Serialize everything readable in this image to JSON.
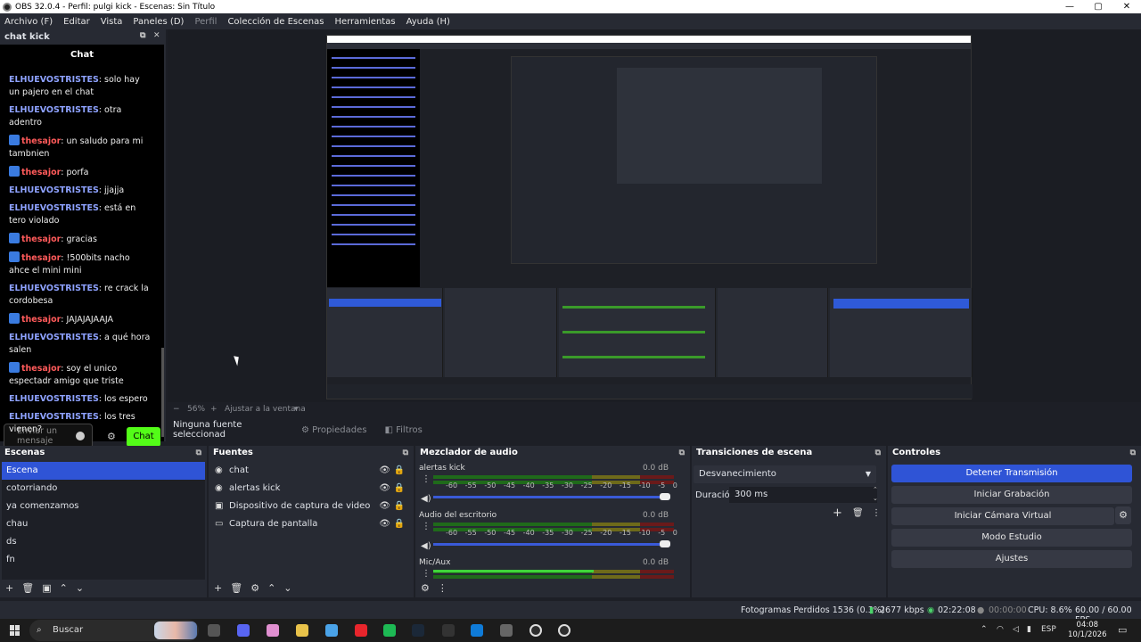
{
  "window": {
    "title": "OBS 32.0.4 - Perfil: pulgi kick - Escenas: Sin Título",
    "controls": [
      "—",
      "▢",
      "✕"
    ]
  },
  "menu": [
    {
      "label": "Archivo (F)",
      "dim": false
    },
    {
      "label": "Editar",
      "dim": false
    },
    {
      "label": "Vista",
      "dim": false
    },
    {
      "label": "Paneles (D)",
      "dim": false
    },
    {
      "label": "Perfil",
      "dim": true
    },
    {
      "label": "Colección de Escenas",
      "dim": false
    },
    {
      "label": "Herramientas",
      "dim": false
    },
    {
      "label": "Ayuda (H)",
      "dim": false
    }
  ],
  "chat_dock": {
    "title": "chat kick",
    "panel_title": "Chat",
    "messages": [
      {
        "user": "ELHUEVOSTRISTES",
        "badge": false,
        "text": "solo hay un pajero en el chat"
      },
      {
        "user": "ELHUEVOSTRISTES",
        "badge": false,
        "text": "otra adentro"
      },
      {
        "user": "thesajor",
        "badge": true,
        "text": "un saludo para mi tambnien"
      },
      {
        "user": "thesajor",
        "badge": true,
        "text": "porfa"
      },
      {
        "user": "ELHUEVOSTRISTES",
        "badge": false,
        "text": "jjajja"
      },
      {
        "user": "ELHUEVOSTRISTES",
        "badge": false,
        "text": "está en tero violado"
      },
      {
        "user": "thesajor",
        "badge": true,
        "text": "gracias"
      },
      {
        "user": "thesajor",
        "badge": true,
        "text": "!500bits nacho ahce el mini mini"
      },
      {
        "user": "ELHUEVOSTRISTES",
        "badge": false,
        "text": "re crack la cordobesa"
      },
      {
        "user": "thesajor",
        "badge": true,
        "text": "JAJAJAJAAJA"
      },
      {
        "user": "ELHUEVOSTRISTES",
        "badge": false,
        "text": "a qué hora salen"
      },
      {
        "user": "thesajor",
        "badge": true,
        "text": "soy el unico espectadr amigo que triste"
      },
      {
        "user": "ELHUEVOSTRISTES",
        "badge": false,
        "text": "los espero"
      },
      {
        "user": "ELHUEVOSTRISTES",
        "badge": false,
        "text": "los tres vienen?"
      }
    ],
    "input_placeholder": "Enviar un mensaje",
    "send_label": "Chat",
    "colors": {
      "user_blue": "#8ea2ff",
      "user_red": "#ff5a5a",
      "send_green": "#53fc18"
    }
  },
  "preview": {
    "zoom": "56%",
    "fit_label": "Ajustar a la ventana",
    "zoom_minus": "−",
    "zoom_plus": "+",
    "no_source": "Ninguna fuente seleccionad",
    "properties": "Propiedades",
    "filters": "Filtros"
  },
  "scenes": {
    "title": "Escenas",
    "items": [
      "Escena",
      "cotorriando",
      "ya comenzamos",
      "chau",
      "ds",
      "fn"
    ],
    "selected": 0,
    "toolbar": [
      "+",
      "🗑",
      "▣",
      "⌃",
      "⌄"
    ]
  },
  "sources": {
    "title": "Fuentes",
    "items": [
      {
        "name": "chat",
        "icon": "browser-icon"
      },
      {
        "name": "alertas kick",
        "icon": "browser-icon"
      },
      {
        "name": "Dispositivo de captura de video",
        "icon": "camera-icon"
      },
      {
        "name": "Captura de pantalla",
        "icon": "monitor-icon"
      }
    ],
    "toolbar": [
      "+",
      "🗑",
      "⚙",
      "⌃",
      "⌄"
    ]
  },
  "mixer": {
    "title": "Mezclador de audio",
    "channels": [
      {
        "name": "alertas kick",
        "db": "0.0 dB"
      },
      {
        "name": "Audio del escritorio",
        "db": "0.0 dB"
      },
      {
        "name": "Mic/Aux",
        "db": "0.0 dB"
      }
    ],
    "scale": [
      "-60",
      "-55",
      "-50",
      "-45",
      "-40",
      "-35",
      "-30",
      "-25",
      "-20",
      "-15",
      "-10",
      "-5",
      "0"
    ]
  },
  "transitions": {
    "title": "Transiciones de escena",
    "selected": "Desvanecimiento",
    "duration_label": "Duración",
    "duration_value": "300 ms"
  },
  "controls": {
    "title": "Controles",
    "buttons": [
      "Detener Transmisión",
      "Iniciar Grabación",
      "Iniciar Cámara Virtual",
      "Modo Estudio",
      "Ajustes"
    ]
  },
  "status": {
    "dropped": "Fotogramas Perdidos 1536 (0.3%)",
    "bitrate": "2677 kbps",
    "stream_time": "02:22:08",
    "rec_time": "00:00:00",
    "cpu": "CPU: 8.6%",
    "fps": "60.00 / 60.00 FPS",
    "colors": {
      "live": "#2ecc40"
    }
  },
  "taskbar": {
    "search_placeholder": "Buscar",
    "lang": "ESP",
    "time": "04:08",
    "date": "10/1/2026",
    "icons": [
      "task-view-icon",
      "discord-icon",
      "copilot-icon",
      "file-explorer-icon",
      "store-icon",
      "opera-icon",
      "spotify-icon",
      "steam-icon",
      "epic-icon",
      "edge-icon",
      "audio-app-icon",
      "obs-icon",
      "obs-alt-icon"
    ]
  }
}
